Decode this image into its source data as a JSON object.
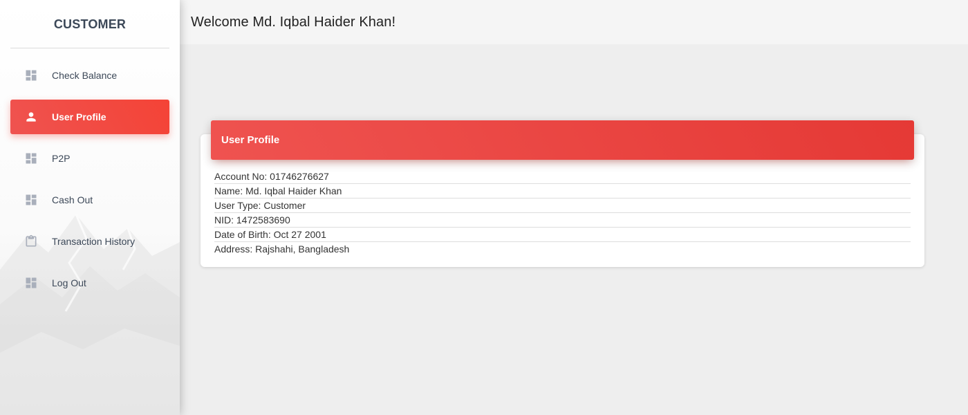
{
  "sidebar": {
    "brand": "CUSTOMER",
    "items": [
      {
        "label": "Check Balance",
        "icon": "dashboard-icon",
        "active": false
      },
      {
        "label": "User Profile",
        "icon": "person-icon",
        "active": true
      },
      {
        "label": "P2P",
        "icon": "dashboard-icon",
        "active": false
      },
      {
        "label": "Cash Out",
        "icon": "dashboard-icon",
        "active": false
      },
      {
        "label": "Transaction History",
        "icon": "clipboard-icon",
        "active": false
      },
      {
        "label": "Log Out",
        "icon": "dashboard-icon",
        "active": false
      }
    ]
  },
  "header": {
    "welcome": "Welcome Md. Iqbal Haider Khan!"
  },
  "profile": {
    "title": "User Profile",
    "rows": [
      {
        "label": "Account No:",
        "value": "01746276627"
      },
      {
        "label": "Name:",
        "value": "Md. Iqbal Haider Khan"
      },
      {
        "label": "User Type:",
        "value": "Customer"
      },
      {
        "label": "NID:",
        "value": "1472583690"
      },
      {
        "label": "Date of Birth:",
        "value": "Oct 27 2001"
      },
      {
        "label": "Address:",
        "value": "Rajshahi, Bangladesh"
      }
    ]
  },
  "colors": {
    "accent": "#f44336",
    "accent_dark": "#e53935",
    "sidebar_text": "#3c4858",
    "icon_gray": "#a9afbb",
    "background": "#eeeeee"
  }
}
